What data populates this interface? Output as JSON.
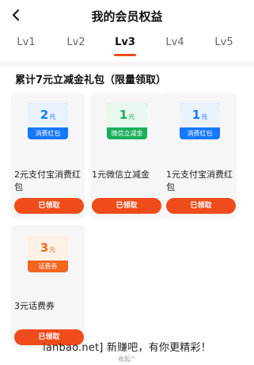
{
  "header": {
    "title": "我的会员权益"
  },
  "tabs": [
    "Lv1",
    "Lv2",
    "Lv3",
    "Lv4",
    "Lv5"
  ],
  "active_tab": "Lv3",
  "section_title": "累计7元立减金礼包（限量领取）",
  "cards": [
    {
      "amount": "2",
      "unit": "元",
      "badge": "消费红包",
      "name": "2元支付宝消费红包",
      "button": "已领取",
      "theme": "alipay"
    },
    {
      "amount": "1",
      "unit": "元",
      "badge": "微信立减金",
      "name": "1元微信立减金",
      "button": "已领取",
      "theme": "wechat"
    },
    {
      "amount": "1",
      "unit": "元",
      "badge": "消费红包",
      "name": "1元支付宝消费红包",
      "button": "已领取",
      "theme": "alipay"
    },
    {
      "amount": "3",
      "unit": "元",
      "badge": "话费券",
      "name": "3元话费券",
      "button": "已领取",
      "theme": "phone"
    }
  ],
  "watermark": "ianbao.net] 新赚吧，有你更精彩！",
  "collapse_label": "收起^",
  "colors": {
    "accent": "#f04b1a",
    "alipay_blue": "#1677ff",
    "wechat_green": "#1aad5a",
    "phone_orange": "#f2661f"
  }
}
